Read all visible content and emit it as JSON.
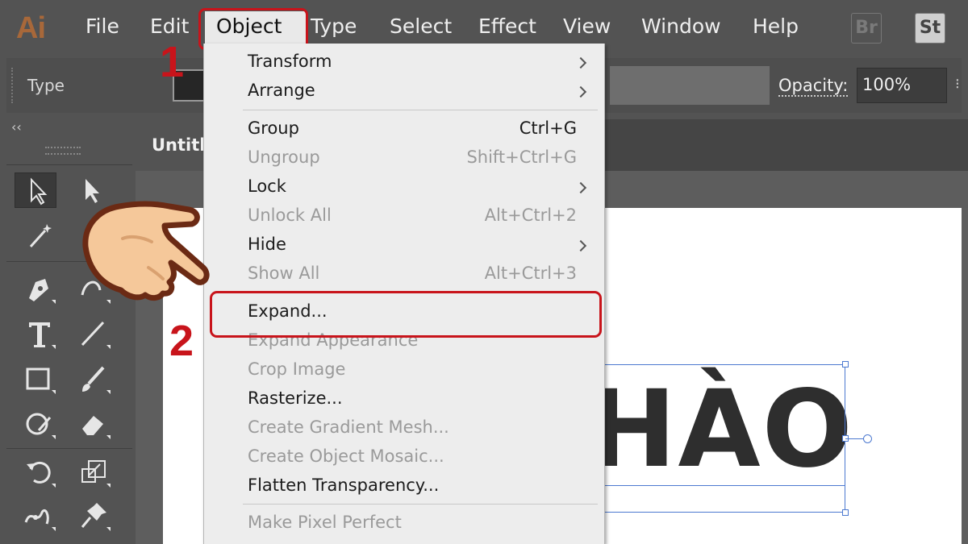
{
  "app": {
    "logo": "Ai"
  },
  "menubar": {
    "items": [
      "File",
      "Edit",
      "Object",
      "Type",
      "Select",
      "Effect",
      "View",
      "Window",
      "Help"
    ],
    "active": "Object",
    "bridge_btn": "Br",
    "stock_btn": "St"
  },
  "controlbar": {
    "type_label": "Type",
    "opacity_label": "Opacity:",
    "opacity_value": "100%"
  },
  "document": {
    "tab_title": "Untitl",
    "artwork_text": "HÀO"
  },
  "tools": [
    "selection-tool",
    "direct-selection-tool",
    "magic-wand-tool",
    "lasso-tool",
    "pen-tool",
    "curvature-tool",
    "type-tool",
    "line-segment-tool",
    "rectangle-tool",
    "paintbrush-tool",
    "shaper-tool",
    "eraser-tool",
    "rotate-tool",
    "scale-tool",
    "puppet-warp-tool",
    "pin-tool"
  ],
  "object_menu": {
    "items": [
      {
        "label": "Transform",
        "shortcut": "",
        "submenu": true,
        "enabled": true
      },
      {
        "label": "Arrange",
        "shortcut": "",
        "submenu": true,
        "enabled": true
      },
      {
        "label": "Group",
        "shortcut": "Ctrl+G",
        "submenu": false,
        "enabled": true
      },
      {
        "label": "Ungroup",
        "shortcut": "Shift+Ctrl+G",
        "submenu": false,
        "enabled": false
      },
      {
        "label": "Lock",
        "shortcut": "",
        "submenu": true,
        "enabled": true
      },
      {
        "label": "Unlock All",
        "shortcut": "Alt+Ctrl+2",
        "submenu": false,
        "enabled": false
      },
      {
        "label": "Hide",
        "shortcut": "",
        "submenu": true,
        "enabled": true
      },
      {
        "label": "Show All",
        "shortcut": "Alt+Ctrl+3",
        "submenu": false,
        "enabled": false
      },
      {
        "label": "Expand...",
        "shortcut": "",
        "submenu": false,
        "enabled": true
      },
      {
        "label": "Expand Appearance",
        "shortcut": "",
        "submenu": false,
        "enabled": false
      },
      {
        "label": "Crop Image",
        "shortcut": "",
        "submenu": false,
        "enabled": false
      },
      {
        "label": "Rasterize...",
        "shortcut": "",
        "submenu": false,
        "enabled": true
      },
      {
        "label": "Create Gradient Mesh...",
        "shortcut": "",
        "submenu": false,
        "enabled": false
      },
      {
        "label": "Create Object Mosaic...",
        "shortcut": "",
        "submenu": false,
        "enabled": false
      },
      {
        "label": "Flatten Transparency...",
        "shortcut": "",
        "submenu": false,
        "enabled": true
      },
      {
        "label": "Make Pixel Perfect",
        "shortcut": "",
        "submenu": false,
        "enabled": false
      }
    ]
  },
  "annotations": {
    "step1": "1",
    "step2": "2",
    "highlight_color": "#c8141b"
  }
}
